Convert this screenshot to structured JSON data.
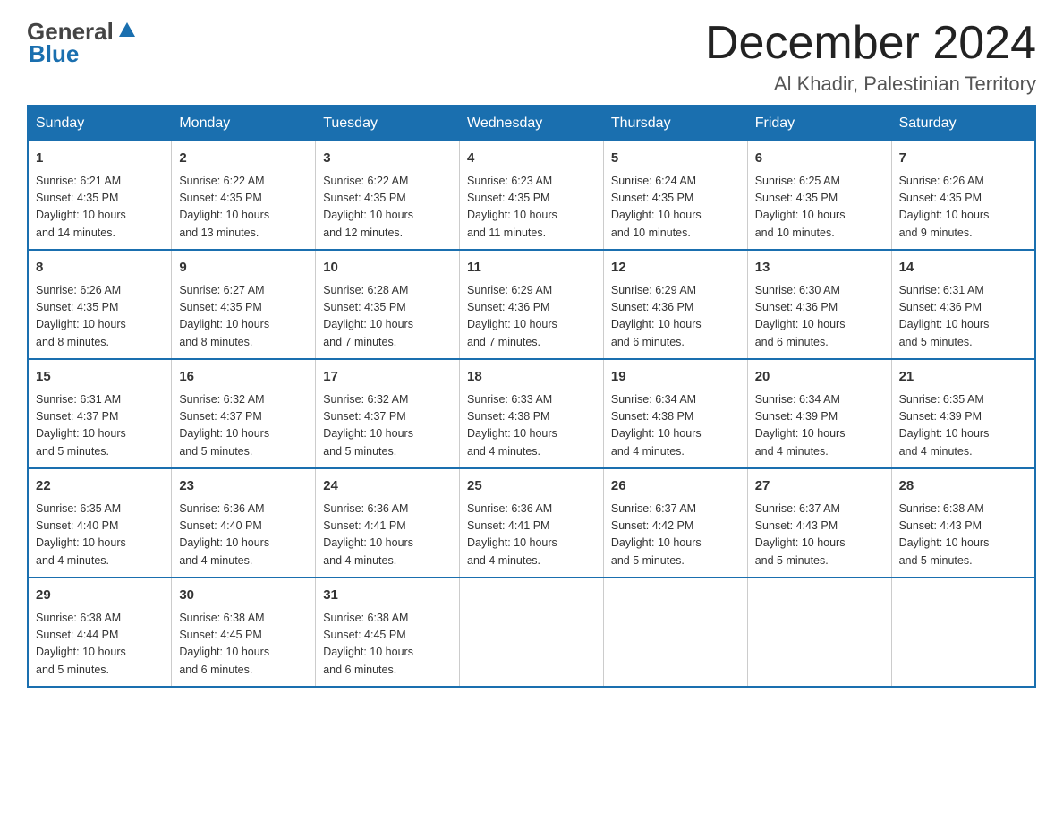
{
  "header": {
    "logo_general": "General",
    "logo_blue": "Blue",
    "month_title": "December 2024",
    "subtitle": "Al Khadir, Palestinian Territory"
  },
  "days_of_week": [
    "Sunday",
    "Monday",
    "Tuesday",
    "Wednesday",
    "Thursday",
    "Friday",
    "Saturday"
  ],
  "weeks": [
    [
      {
        "day": "1",
        "sunrise": "6:21 AM",
        "sunset": "4:35 PM",
        "daylight": "10 hours and 14 minutes."
      },
      {
        "day": "2",
        "sunrise": "6:22 AM",
        "sunset": "4:35 PM",
        "daylight": "10 hours and 13 minutes."
      },
      {
        "day": "3",
        "sunrise": "6:22 AM",
        "sunset": "4:35 PM",
        "daylight": "10 hours and 12 minutes."
      },
      {
        "day": "4",
        "sunrise": "6:23 AM",
        "sunset": "4:35 PM",
        "daylight": "10 hours and 11 minutes."
      },
      {
        "day": "5",
        "sunrise": "6:24 AM",
        "sunset": "4:35 PM",
        "daylight": "10 hours and 10 minutes."
      },
      {
        "day": "6",
        "sunrise": "6:25 AM",
        "sunset": "4:35 PM",
        "daylight": "10 hours and 10 minutes."
      },
      {
        "day": "7",
        "sunrise": "6:26 AM",
        "sunset": "4:35 PM",
        "daylight": "10 hours and 9 minutes."
      }
    ],
    [
      {
        "day": "8",
        "sunrise": "6:26 AM",
        "sunset": "4:35 PM",
        "daylight": "10 hours and 8 minutes."
      },
      {
        "day": "9",
        "sunrise": "6:27 AM",
        "sunset": "4:35 PM",
        "daylight": "10 hours and 8 minutes."
      },
      {
        "day": "10",
        "sunrise": "6:28 AM",
        "sunset": "4:35 PM",
        "daylight": "10 hours and 7 minutes."
      },
      {
        "day": "11",
        "sunrise": "6:29 AM",
        "sunset": "4:36 PM",
        "daylight": "10 hours and 7 minutes."
      },
      {
        "day": "12",
        "sunrise": "6:29 AM",
        "sunset": "4:36 PM",
        "daylight": "10 hours and 6 minutes."
      },
      {
        "day": "13",
        "sunrise": "6:30 AM",
        "sunset": "4:36 PM",
        "daylight": "10 hours and 6 minutes."
      },
      {
        "day": "14",
        "sunrise": "6:31 AM",
        "sunset": "4:36 PM",
        "daylight": "10 hours and 5 minutes."
      }
    ],
    [
      {
        "day": "15",
        "sunrise": "6:31 AM",
        "sunset": "4:37 PM",
        "daylight": "10 hours and 5 minutes."
      },
      {
        "day": "16",
        "sunrise": "6:32 AM",
        "sunset": "4:37 PM",
        "daylight": "10 hours and 5 minutes."
      },
      {
        "day": "17",
        "sunrise": "6:32 AM",
        "sunset": "4:37 PM",
        "daylight": "10 hours and 5 minutes."
      },
      {
        "day": "18",
        "sunrise": "6:33 AM",
        "sunset": "4:38 PM",
        "daylight": "10 hours and 4 minutes."
      },
      {
        "day": "19",
        "sunrise": "6:34 AM",
        "sunset": "4:38 PM",
        "daylight": "10 hours and 4 minutes."
      },
      {
        "day": "20",
        "sunrise": "6:34 AM",
        "sunset": "4:39 PM",
        "daylight": "10 hours and 4 minutes."
      },
      {
        "day": "21",
        "sunrise": "6:35 AM",
        "sunset": "4:39 PM",
        "daylight": "10 hours and 4 minutes."
      }
    ],
    [
      {
        "day": "22",
        "sunrise": "6:35 AM",
        "sunset": "4:40 PM",
        "daylight": "10 hours and 4 minutes."
      },
      {
        "day": "23",
        "sunrise": "6:36 AM",
        "sunset": "4:40 PM",
        "daylight": "10 hours and 4 minutes."
      },
      {
        "day": "24",
        "sunrise": "6:36 AM",
        "sunset": "4:41 PM",
        "daylight": "10 hours and 4 minutes."
      },
      {
        "day": "25",
        "sunrise": "6:36 AM",
        "sunset": "4:41 PM",
        "daylight": "10 hours and 4 minutes."
      },
      {
        "day": "26",
        "sunrise": "6:37 AM",
        "sunset": "4:42 PM",
        "daylight": "10 hours and 5 minutes."
      },
      {
        "day": "27",
        "sunrise": "6:37 AM",
        "sunset": "4:43 PM",
        "daylight": "10 hours and 5 minutes."
      },
      {
        "day": "28",
        "sunrise": "6:38 AM",
        "sunset": "4:43 PM",
        "daylight": "10 hours and 5 minutes."
      }
    ],
    [
      {
        "day": "29",
        "sunrise": "6:38 AM",
        "sunset": "4:44 PM",
        "daylight": "10 hours and 5 minutes."
      },
      {
        "day": "30",
        "sunrise": "6:38 AM",
        "sunset": "4:45 PM",
        "daylight": "10 hours and 6 minutes."
      },
      {
        "day": "31",
        "sunrise": "6:38 AM",
        "sunset": "4:45 PM",
        "daylight": "10 hours and 6 minutes."
      },
      null,
      null,
      null,
      null
    ]
  ],
  "labels": {
    "sunrise": "Sunrise:",
    "sunset": "Sunset:",
    "daylight": "Daylight:"
  }
}
